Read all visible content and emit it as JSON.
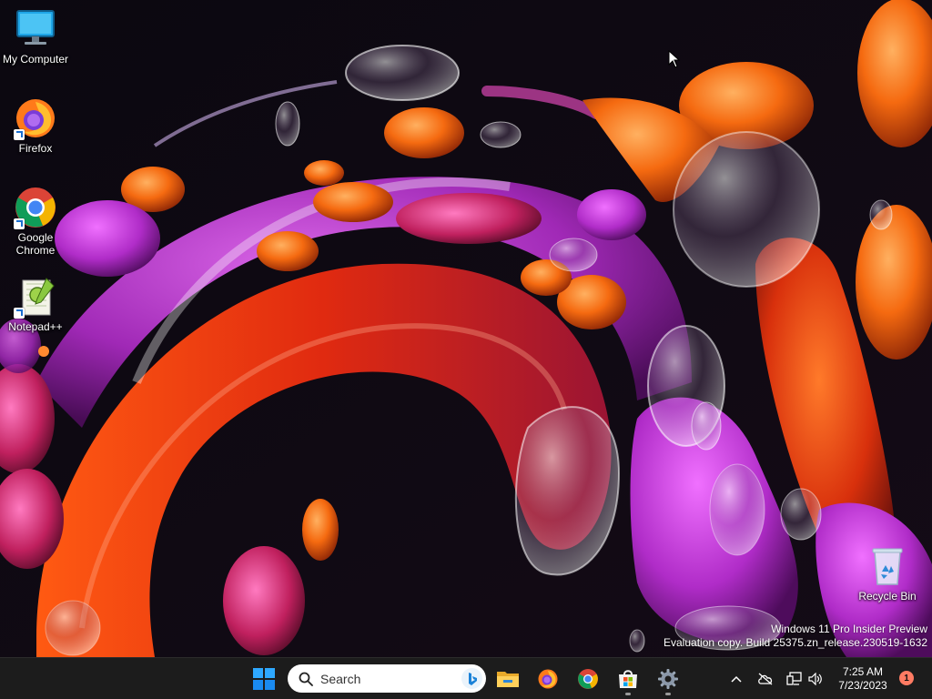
{
  "desktop": {
    "icons": [
      {
        "label": "My Computer"
      },
      {
        "label": "Firefox"
      },
      {
        "label_line1": "Google",
        "label_line2": "Chrome"
      },
      {
        "label": "Notepad++"
      },
      {
        "label": "Recycle Bin"
      }
    ],
    "watermark": {
      "line1": "Windows 11 Pro Insider Preview",
      "line2": "Evaluation copy. Build 25375.zn_release.230519-1632"
    }
  },
  "taskbar": {
    "start_icon": "windows-logo-icon",
    "search": {
      "label": "Search",
      "icon": "search-icon",
      "bing_icon": "bing-icon"
    },
    "pinned": [
      {
        "name": "file-explorer-icon"
      },
      {
        "name": "firefox-icon"
      },
      {
        "name": "chrome-icon"
      },
      {
        "name": "microsoft-store-icon"
      },
      {
        "name": "settings-icon"
      }
    ],
    "tray": {
      "time": "7:25 AM",
      "date": "7/23/2023",
      "notification_count": "1"
    }
  },
  "colors": {
    "taskbar_bg": "#1c1c1c",
    "accent_orange": "#ff6a14",
    "accent_magenta": "#c23bd8",
    "notification_badge": "#ff7b63"
  }
}
